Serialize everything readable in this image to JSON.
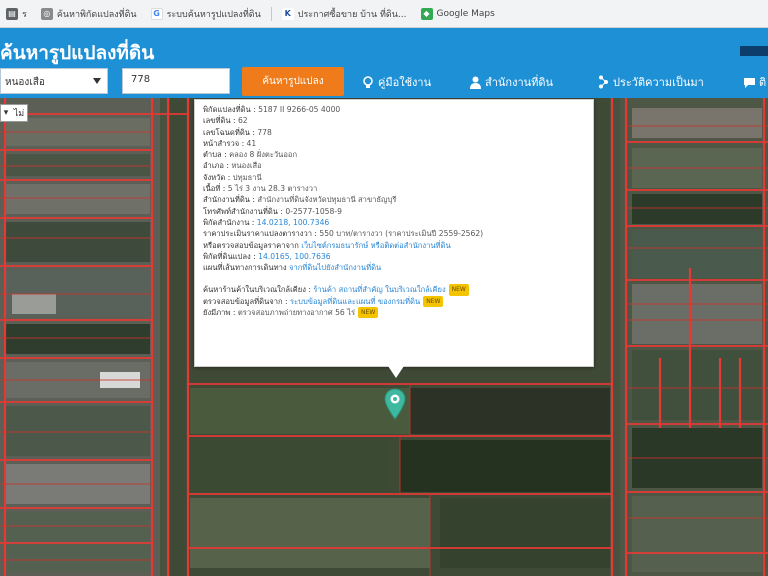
{
  "bookmarks": [
    {
      "icon": "bookmark-icon",
      "label": "ร"
    },
    {
      "icon": "globe-icon",
      "label": "ค้นหาพิกัดแปลงที่ดิน"
    },
    {
      "icon": "g-logo-icon",
      "label": "ระบบค้นหารูปแปลงที่ดิน"
    },
    {
      "icon": "k-logo-icon",
      "label": "ประกาศซื้อขาย บ้าน ที่ดิน..."
    },
    {
      "icon": "maps-icon",
      "label": "Google Maps"
    }
  ],
  "header": {
    "title": "ค้นหารูปแปลงที่ดิน",
    "province_select": "หนองเสือ",
    "parcel_number": "778",
    "search_button": "ค้นหารูปแปลง",
    "nav": [
      {
        "label": "คู่มือใช้งาน"
      },
      {
        "label": "สำนักงานที่ดิน"
      },
      {
        "label": "ประวัติความเป็นมา"
      },
      {
        "label": "ติ"
      }
    ]
  },
  "map": {
    "control_label": "ไม่",
    "accent": "#e53935"
  },
  "popup": {
    "rows": [
      {
        "label": "พิกัดแปลงที่ดิน :",
        "value": "5187 II 9266-05 4000"
      },
      {
        "label": "เลขที่ดิน :",
        "value": "62"
      },
      {
        "label": "เลขโฉนดที่ดิน :",
        "value": "778"
      },
      {
        "label": "หน้าสำรวจ :",
        "value": "41"
      },
      {
        "label": "ตำบล :",
        "value": "คลอง 8 ฝั่งตะวันออก"
      },
      {
        "label": "อำเภอ :",
        "value": "หนองเสือ"
      },
      {
        "label": "จังหวัด :",
        "value": "ปทุมธานี"
      },
      {
        "label": "เนื้อที่ :",
        "value": "5 ไร่ 3 งาน 28.3 ตารางวา"
      },
      {
        "label": "สำนักงานที่ดิน :",
        "value": "สำนักงานที่ดินจังหวัดปทุมธานี สาขาธัญบุรี"
      },
      {
        "label": "โทรศัพท์สำนักงานที่ดิน :",
        "value": "0-2577-1058-9"
      },
      {
        "label": "พิกัดสำนักงาน :",
        "value": "14.0218, 100.7346",
        "link": true
      },
      {
        "label": "ราคาประเมินราคาแปลงตารางวา :",
        "value": "550 บาท/ตารางวา (ราคาประเมินปี 2559-2562)"
      },
      {
        "label": "หรือตรวจสอบข้อมูลราคาจาก",
        "value": "เว็บไซต์กรมธนารักษ์ หรือติดต่อสำนักงานที่ดิน",
        "link": true
      },
      {
        "label": "พิกัดที่ดินแปลง :",
        "value": "14.0165, 100.7636",
        "link": true
      },
      {
        "label": "แผนที่เส้นทางการเดินทาง",
        "value": "จากที่ดินไปยังสำนักงานที่ดิน",
        "link": true
      },
      {
        "gap": true
      },
      {
        "label": "ค้นหาร้านค้าในบริเวณใกล้เคียง :",
        "value": "ร้านค้า สถานที่สำคัญ ในบริเวณใกล้เคียง",
        "link": true,
        "badge": "NEW"
      },
      {
        "label": "ตรวจสอบข้อมูลที่ดินจาก :",
        "value": "ระบบข้อมูลที่ดินและแผนที่ ของกรมที่ดิน",
        "link": true,
        "badge": "NEW"
      },
      {
        "label": "ยังมีภาพ :",
        "value": "ตรวจสอบภาพถ่ายทางอากาศ 56 ไร่",
        "badge": "NEW"
      }
    ]
  }
}
